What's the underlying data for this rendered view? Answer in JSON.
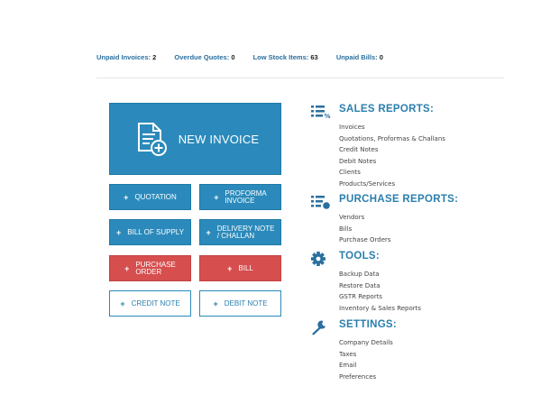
{
  "status": {
    "unpaid_invoices_label": "Unpaid Invoices:",
    "unpaid_invoices_value": "2",
    "overdue_quotes_label": "Overdue Quotes:",
    "overdue_quotes_value": "0",
    "low_stock_label": "Low Stock Items:",
    "low_stock_value": "63",
    "unpaid_bills_label": "Unpaid Bills:",
    "unpaid_bills_value": "0"
  },
  "actions": {
    "new_invoice": "NEW INVOICE",
    "quotation": "QUOTATION",
    "proforma_invoice_l1": "PROFORMA",
    "proforma_invoice_l2": "INVOICE",
    "bill_of_supply": "BILL OF SUPPLY",
    "delivery_note_l1": "DELIVERY NOTE",
    "delivery_note_l2": "/ CHALLAN",
    "purchase_order_l1": "PURCHASE",
    "purchase_order_l2": "ORDER",
    "bill": "BILL",
    "credit_note": "CREDIT NOTE",
    "debit_note": "DEBIT NOTE",
    "plus": "+"
  },
  "sales_reports": {
    "title": "SALES REPORTS:",
    "items": [
      "Invoices",
      "Quotations, Proformas & Challans",
      "Credit Notes",
      "Debit Notes",
      "Clients",
      "Products/Services"
    ]
  },
  "purchase_reports": {
    "title": "PURCHASE REPORTS:",
    "items": [
      "Vendors",
      "Bills",
      "Purchase Orders"
    ]
  },
  "tools": {
    "title": "TOOLS:",
    "items": [
      "Backup Data",
      "Restore Data",
      "GSTR Reports",
      "Inventory & Sales Reports"
    ]
  },
  "settings": {
    "title": "SETTINGS:",
    "items": [
      "Company Details",
      "Taxes",
      "Email",
      "Preferences"
    ]
  },
  "colors": {
    "primary": "#2b8abb",
    "danger": "#d64e4e",
    "link": "#2a7fae"
  }
}
